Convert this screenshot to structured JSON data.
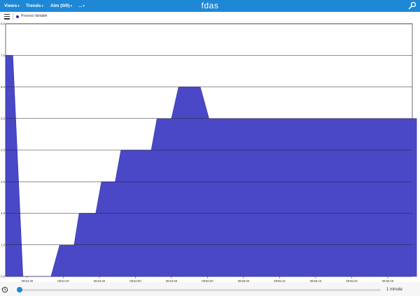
{
  "topbar": {
    "menus": [
      {
        "label": "Views"
      },
      {
        "label": "Trends"
      },
      {
        "label": "Alm (0/0)"
      },
      {
        "label": "..."
      }
    ],
    "title": "fdas"
  },
  "legend": {
    "label": "Process Variable",
    "color": "#2b2ea8"
  },
  "bottom": {
    "range_label": "1 minute",
    "slider_position": 0
  },
  "chart_data": {
    "type": "area",
    "title": "",
    "xlabel": "",
    "ylabel": "",
    "ylim": [
      0,
      8
    ],
    "yticks": [
      "0.0",
      "1.0",
      "2.0",
      "3.0",
      "4.0",
      "5.0",
      "6.0",
      "7.0",
      "8.0"
    ],
    "xticks": [
      "08:54:35",
      "08:54:40",
      "08:54:45",
      "08:54:50",
      "08:54:55",
      "08:55:00",
      "08:55:05",
      "08:55:10",
      "08:55:15",
      "08:55:20",
      "08:55:25"
    ],
    "grid": true,
    "fill_color": "#4a48c6",
    "series": [
      {
        "name": "Process Variable",
        "points": [
          [
            "08:54:32.0",
            7
          ],
          [
            "08:54:33.0",
            7
          ],
          [
            "08:54:34.4",
            0
          ],
          [
            "08:54:38.3",
            0
          ],
          [
            "08:54:39.5",
            1
          ],
          [
            "08:54:41.5",
            1
          ],
          [
            "08:54:42.2",
            2
          ],
          [
            "08:54:44.5",
            2
          ],
          [
            "08:54:45.3",
            3
          ],
          [
            "08:54:47.2",
            3
          ],
          [
            "08:54:48.0",
            4
          ],
          [
            "08:54:52.2",
            4
          ],
          [
            "08:54:53.0",
            5
          ],
          [
            "08:54:55.0",
            5
          ],
          [
            "08:54:56.0",
            6
          ],
          [
            "08:54:59.0",
            6
          ],
          [
            "08:55:00.2",
            5
          ],
          [
            "08:55:29.0",
            5
          ]
        ]
      }
    ]
  }
}
